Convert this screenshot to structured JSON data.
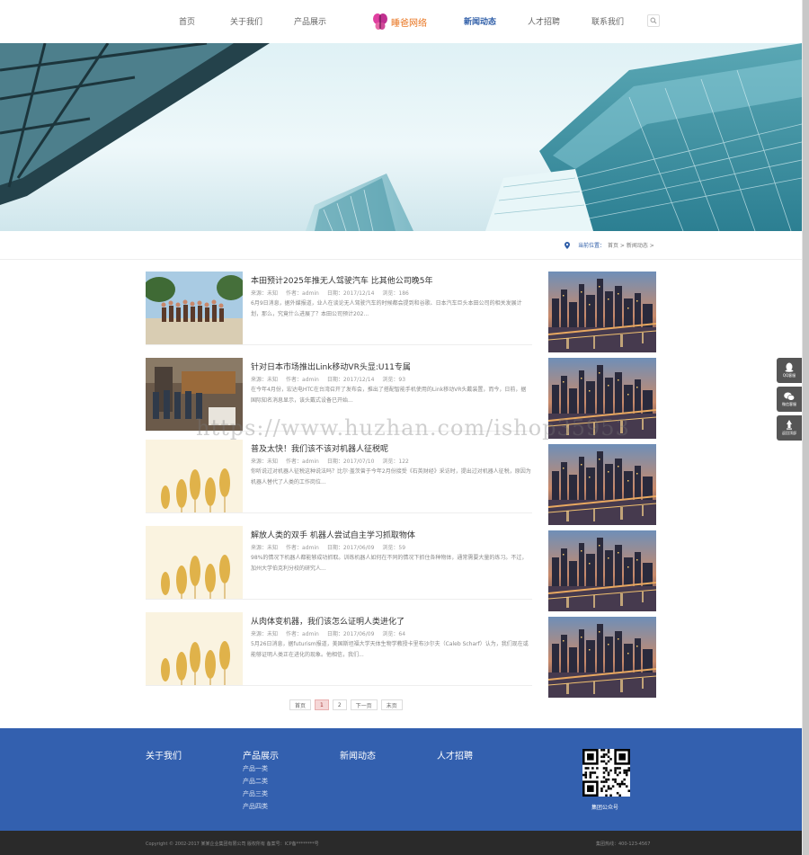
{
  "nav": {
    "items": [
      {
        "label": "首页"
      },
      {
        "label": "关于我们"
      },
      {
        "label": "产品展示"
      },
      {
        "label": "新闻动态"
      },
      {
        "label": "人才招聘"
      },
      {
        "label": "联系我们"
      }
    ],
    "active_index": 3,
    "logo_text": "睡爸网络",
    "accent_color": "#2f5ea8",
    "search_icon": "search-icon"
  },
  "breadcrumb": {
    "label": "当前位置：",
    "path": "首页 > 新闻动态 >"
  },
  "news": [
    {
      "title": "本田预计2025年推无人驾驶汽车 比其他公司晚5年",
      "author": "作者：admin",
      "source": "来源：未知",
      "date": "日期：2017/12/14",
      "views": "浏览：186",
      "desc": "6月9日消息，据外媒报道，业人在谈论无人驾驶汽车的时候都会提到和谷歌、日本汽车巨头本田公司的相关发展计划，那么，究竟什么进展了？本田公司预计202..."
    },
    {
      "title": "针对日本市场推出Link移动VR头显:U11专属",
      "author": "作者：admin",
      "source": "来源：未知",
      "date": "日期：2017/12/14",
      "views": "浏览：93",
      "desc": "在今年4月份，宏达电HTC在台湾召开了发布会，推出了搭配智能手机使用的Link移动VR头戴装置，而今，日前，据国际知名消息显示，该头戴式设备已开始..."
    },
    {
      "title": "普及太快！我们该不该对机器人征税呢",
      "author": "作者：admin",
      "source": "来源：未知",
      "date": "日期：2017/07/10",
      "views": "浏览：122",
      "desc": "你听说过对机器人征税这种说法吗？比尔·盖茨曾于今年2月份接受《石英财经》采访时，提出过对机器人征税，原因为机器人替代了人类的工作岗位..."
    },
    {
      "title": "解放人类的双手 机器人尝试自主学习抓取物体",
      "author": "作者：admin",
      "source": "来源：未知",
      "date": "日期：2017/06/09",
      "views": "浏览：59",
      "desc": "98%的情况下机器人都能够成功抓取。训练机器人如何在不同的情况下抓住各种物体，通常需要大量的练习。不过，加州大学伯克利分校的研究人..."
    },
    {
      "title": "从肉体变机器，我们该怎么证明人类进化了",
      "author": "作者：admin",
      "source": "来源：未知",
      "date": "日期：2017/06/09",
      "views": "浏览：64",
      "desc": "5月26日消息，据futurism报道，美国斯坦福大学天体生物学教授卡里布沙尔夫（Caleb Scharf）认为，我们现在或能够证明人类正在进化的现象。他相信，我们..."
    }
  ],
  "pager": {
    "first": "首页",
    "pages": [
      "1",
      "2"
    ],
    "current": "1",
    "next": "下一页",
    "last": "末页"
  },
  "float_tools": [
    {
      "label": "QQ客服",
      "icon": "qq-icon"
    },
    {
      "label": "微信客服",
      "icon": "wechat-icon"
    },
    {
      "label": "返回顶部",
      "icon": "top-icon"
    }
  ],
  "footer": {
    "columns": [
      {
        "title": "关于我们"
      },
      {
        "title": "产品展示",
        "links": [
          "产品一类",
          "产品二类",
          "产品三类",
          "产品四类"
        ]
      },
      {
        "title": "新闻动态"
      },
      {
        "title": "人才招聘"
      }
    ],
    "qr_label": "集团公众号",
    "copyright": "Copyright © 2002-2017 某某企业集团有限公司 版权所有 备案号：ICP备********号",
    "phone": "集团热线：400-123-4567",
    "background": "#3360af"
  },
  "watermark": "https://www.huzhan.com/ishop35953"
}
